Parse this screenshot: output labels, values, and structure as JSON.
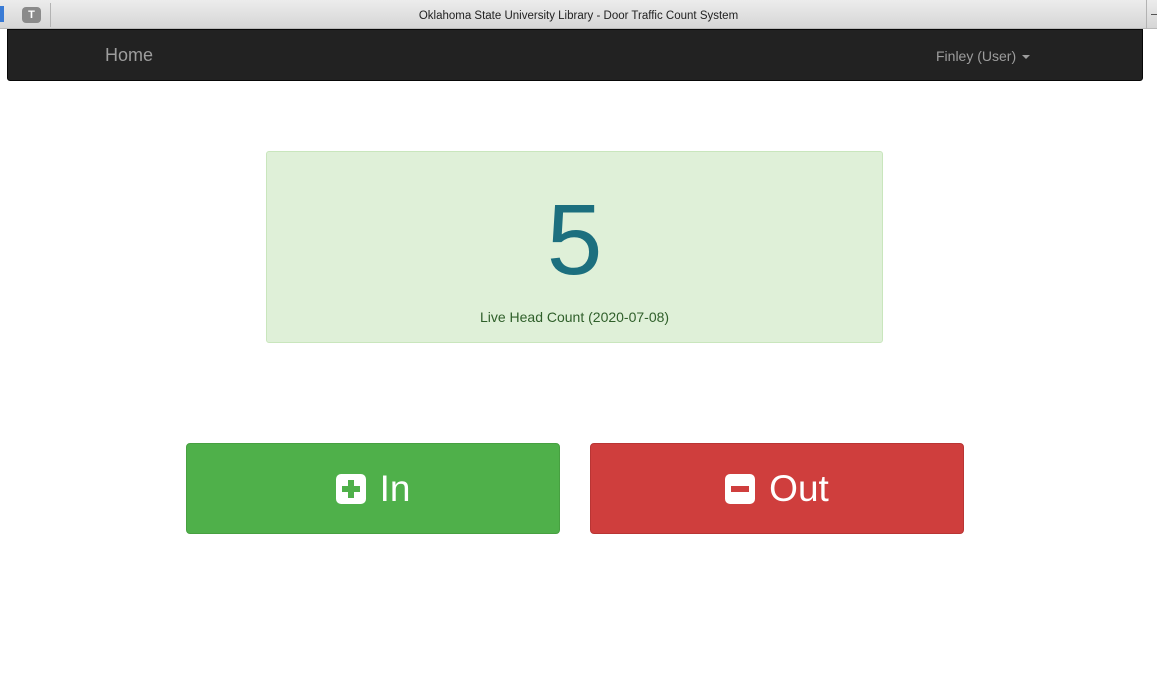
{
  "window": {
    "title": "Oklahoma State University Library - Door Traffic Count System",
    "tab_icon_letter": "T"
  },
  "navbar": {
    "brand": "Home",
    "user_menu": "Finley (User)"
  },
  "headcount": {
    "value": "5",
    "caption": "Live Head Count (2020-07-08)"
  },
  "buttons": {
    "in_label": "In",
    "in_icon": "plus-square-icon",
    "out_label": "Out",
    "out_icon": "minus-square-icon"
  },
  "colors": {
    "navbar_bg": "#222222",
    "panel_bg": "#dff0d8",
    "count_text": "#1c6f7e",
    "in_button": "#4fb04a",
    "out_button": "#cf3e3d"
  }
}
